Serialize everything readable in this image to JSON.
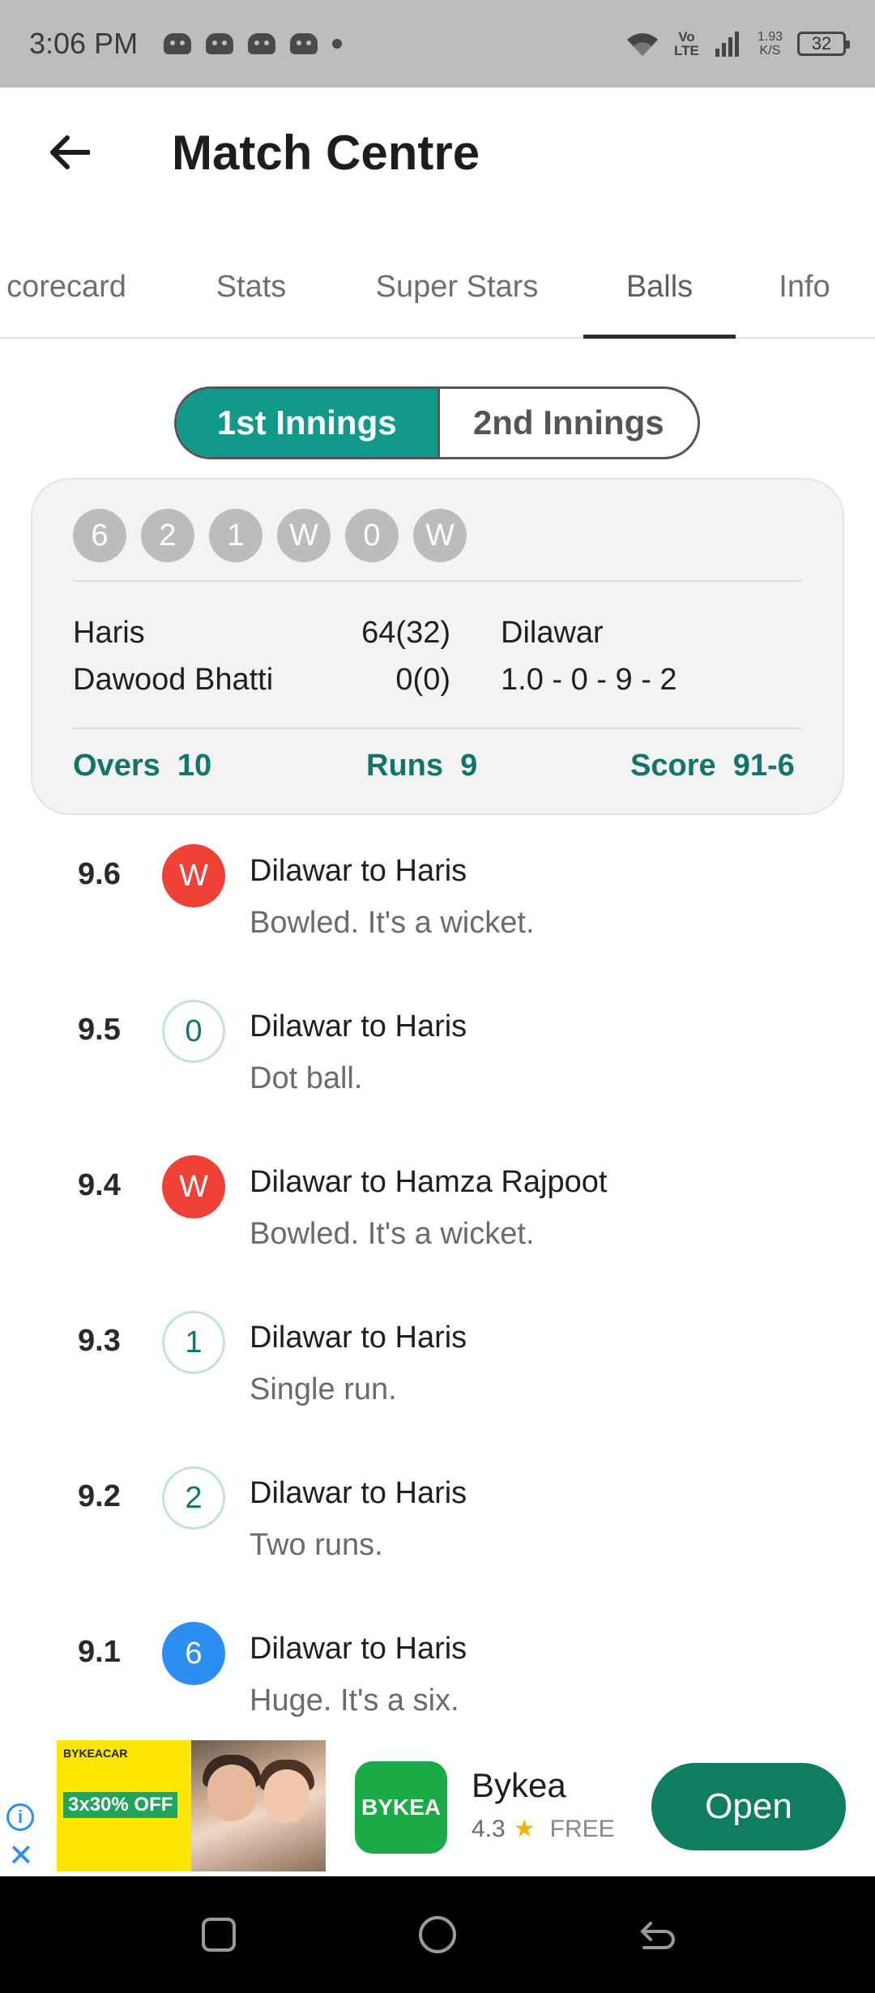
{
  "status_bar": {
    "time": "3:06 PM",
    "volte": [
      "Vo",
      "LTE"
    ],
    "net_speed": [
      "1.93",
      "K/S"
    ],
    "battery": "32",
    "notification_icons": [
      "game-controller-icon",
      "game-controller-icon",
      "game-controller-icon",
      "game-controller-icon",
      "more-dot-icon"
    ]
  },
  "header": {
    "title": "Match Centre",
    "back_icon": "arrow-left-icon"
  },
  "tabs": [
    {
      "label": "corecard",
      "active": false
    },
    {
      "label": "Stats",
      "active": false
    },
    {
      "label": "Super Stars",
      "active": false
    },
    {
      "label": "Balls",
      "active": true
    },
    {
      "label": "Info",
      "active": false
    }
  ],
  "innings": {
    "first": "1st Innings",
    "second": "2nd Innings",
    "selected": "1st Innings"
  },
  "over_card": {
    "recent_balls": [
      "6",
      "2",
      "1",
      "W",
      "0",
      "W"
    ],
    "batsmen": [
      {
        "name": "Haris",
        "score": "64(32)"
      },
      {
        "name": "Dawood Bhatti",
        "score": "0(0)"
      }
    ],
    "bowler": {
      "name": "Dilawar",
      "figures": "1.0 - 0 - 9 - 2"
    },
    "summary": {
      "overs_label": "Overs",
      "overs_value": "10",
      "runs_label": "Runs",
      "runs_value": "9",
      "score_label": "Score",
      "score_value": "91-6"
    }
  },
  "balls": [
    {
      "over": "9.6",
      "outcome": "W",
      "type": "wicket",
      "title": "Dilawar to Haris",
      "desc": "Bowled. It's a wicket."
    },
    {
      "over": "9.5",
      "outcome": "0",
      "type": "run",
      "title": "Dilawar to Haris",
      "desc": "Dot ball."
    },
    {
      "over": "9.4",
      "outcome": "W",
      "type": "wicket",
      "title": "Dilawar to Hamza Rajpoot",
      "desc": "Bowled. It's a wicket."
    },
    {
      "over": "9.3",
      "outcome": "1",
      "type": "run",
      "title": "Dilawar to Haris",
      "desc": "Single run."
    },
    {
      "over": "9.2",
      "outcome": "2",
      "type": "run",
      "title": "Dilawar to Haris",
      "desc": "Two runs."
    },
    {
      "over": "9.1",
      "outcome": "6",
      "type": "six",
      "title": "Dilawar to Haris",
      "desc": "Huge. It's a six."
    }
  ],
  "ad": {
    "image_brand": "BYKEACAR",
    "image_offer": "3x30% OFF",
    "app_icon_text": "BYKEA",
    "app_name": "Bykea",
    "rating": "4.3",
    "price": "FREE",
    "open_label": "Open"
  },
  "colors": {
    "accent": "#12998a",
    "accent_dark": "#11756b",
    "wicket": "#ef4136",
    "six": "#2b8ef0"
  }
}
